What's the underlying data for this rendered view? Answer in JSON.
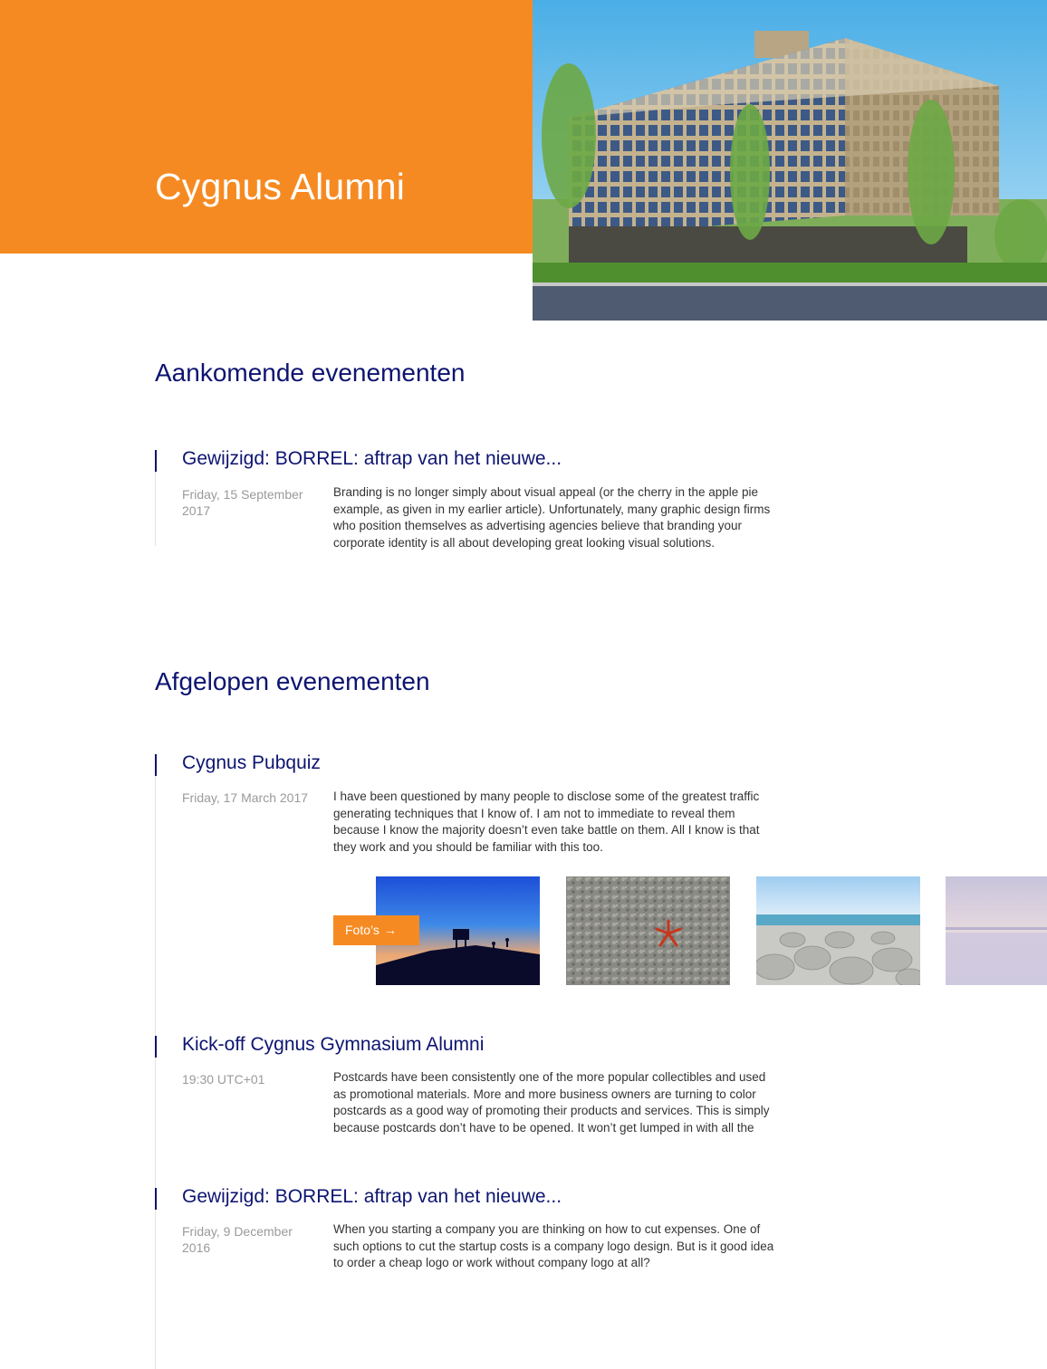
{
  "header": {
    "title": "Cygnus Alumni"
  },
  "upcoming": {
    "heading": "Aankomende evenementen",
    "events": [
      {
        "title": "Gewijzigd: BORREL: aftrap van het nieuwe...",
        "date": "Friday, 15 September 2017",
        "description": "Branding is no longer simply about visual appeal (or the cherry in the apple pie example, as given in my earlier article). Unfortunately, many graphic design firms who position themselves as advertising agencies believe that branding your corporate identity is all about developing great looking visual solutions."
      }
    ]
  },
  "past": {
    "heading": "Afgelopen evenementen",
    "events": [
      {
        "title": "Cygnus Pubquiz",
        "date": "Friday, 17 March 2017",
        "description": "I have been questioned by many people to disclose some of the greatest traffic generating techniques that I know of. I am not to immediate to reveal them because I know the majority doesn’t even take battle on them. All I know is that they work and you should be familiar with this too.",
        "photos_button": "Foto’s",
        "photos_button_icon": "→"
      },
      {
        "title": "Kick-off Cygnus Gymnasium Alumni",
        "date": "19:30 UTC+01",
        "description": "Postcards have been consistently one of the more popular collectibles and used as promotional materials. More and more business owners are turning to color postcards as a good way of promoting their products and services. This is simply because postcards don’t have to be opened. It won’t get lumped in with all the"
      },
      {
        "title": "Gewijzigd: BORREL: aftrap van het nieuwe...",
        "date": "Friday, 9 December 2016",
        "description": "When you starting a company you are thinking on how to cut expenses. One of such options to cut the startup costs is a company logo design. But is it good idea to order a cheap logo or work without company logo at all?"
      }
    ]
  },
  "colors": {
    "brand_orange": "#F68A22",
    "heading_navy": "#0d1470",
    "date_gray": "#9a9a9a"
  }
}
